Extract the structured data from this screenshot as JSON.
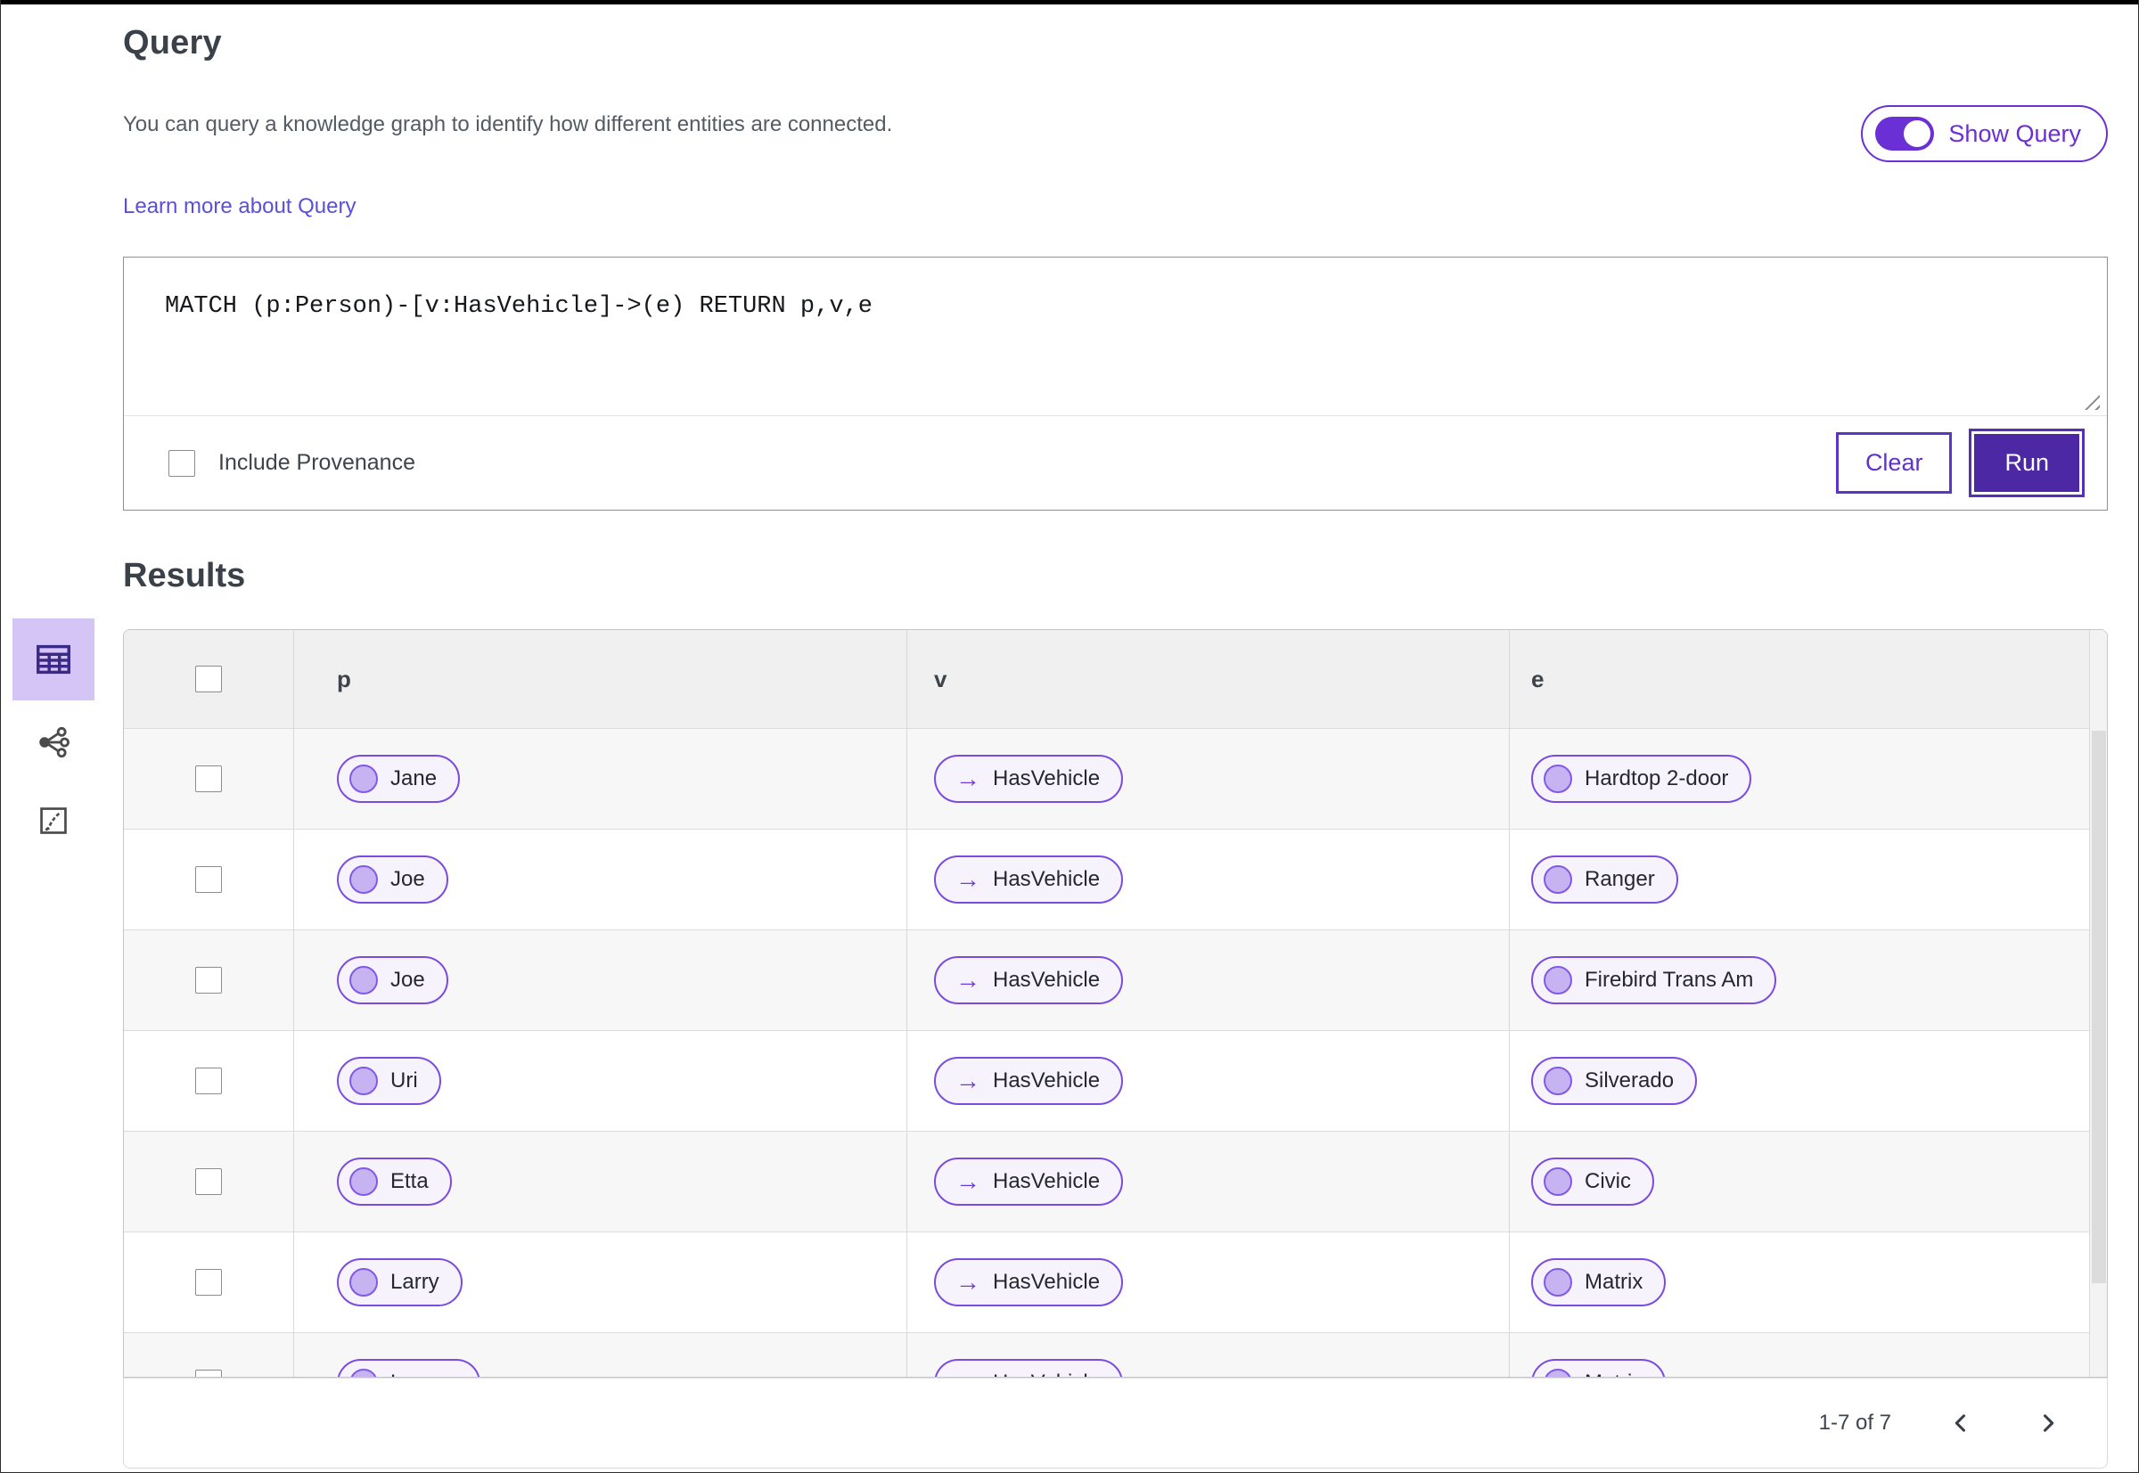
{
  "query_panel": {
    "title": "Query",
    "description": "You can query a knowledge graph to identify how different entities are connected.",
    "learn_more_link": "Learn more about Query",
    "show_query_toggle": {
      "label": "Show Query",
      "state": "on"
    },
    "editor_text": "MATCH (p:Person)-[v:HasVehicle]->(e) RETURN p,v,e",
    "include_provenance": {
      "label": "Include Provenance",
      "checked": false
    },
    "clear_button": "Clear",
    "run_button": "Run"
  },
  "results_panel": {
    "title": "Results",
    "view_switcher": [
      {
        "icon": "table-view-icon",
        "selected": true
      },
      {
        "icon": "graph-view-icon",
        "selected": false
      },
      {
        "icon": "chart-view-icon",
        "selected": false
      }
    ],
    "table": {
      "columns": [
        "p",
        "v",
        "e"
      ],
      "rows": [
        {
          "p": "Jane",
          "v": "HasVehicle",
          "e": "Hardtop 2-door"
        },
        {
          "p": "Joe",
          "v": "HasVehicle",
          "e": "Ranger"
        },
        {
          "p": "Joe",
          "v": "HasVehicle",
          "e": "Firebird Trans Am"
        },
        {
          "p": "Uri",
          "v": "HasVehicle",
          "e": "Silverado"
        },
        {
          "p": "Etta",
          "v": "HasVehicle",
          "e": "Civic"
        },
        {
          "p": "Larry",
          "v": "HasVehicle",
          "e": "Matrix"
        },
        {
          "p": "Lauren",
          "v": "HasVehicle",
          "e": "Matrix"
        }
      ]
    },
    "pagination": {
      "range_label": "1-7 of 7"
    }
  },
  "icons": {
    "arrow_right": "→"
  },
  "colors": {
    "accent_purple": "#6b2fd6",
    "run_button_purple": "#4c28a4",
    "pill_border_purple": "#7b4be0",
    "pill_background": "#f6f3fd",
    "node_circle_fill": "#c7b3f2",
    "selected_view_background": "#d5c4f6",
    "link_blue_purple": "#5a50d8"
  }
}
